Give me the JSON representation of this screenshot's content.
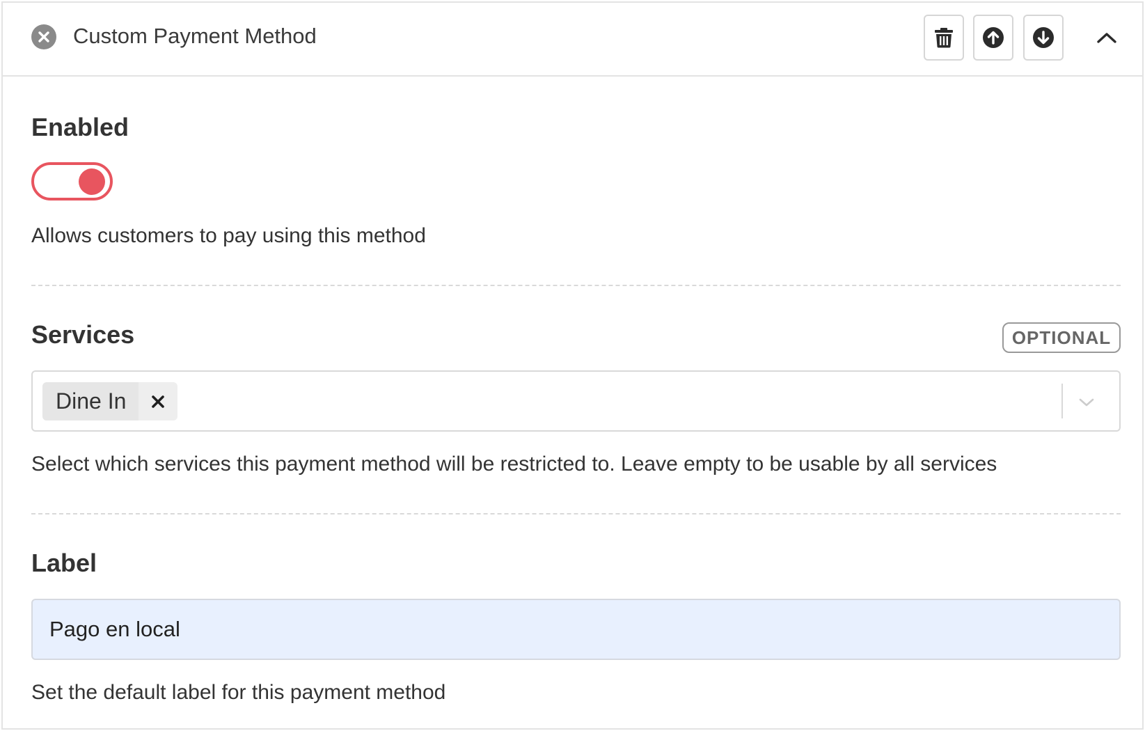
{
  "header": {
    "title": "Custom Payment Method",
    "icons": {
      "dismiss": "close-circle-icon",
      "delete": "trash-icon",
      "move_up": "arrow-up-circle-icon",
      "move_down": "arrow-down-circle-icon",
      "collapse": "chevron-up-icon"
    }
  },
  "enabled": {
    "label": "Enabled",
    "is_on": true,
    "help": "Allows customers to pay using this method"
  },
  "services": {
    "label": "Services",
    "badge": "OPTIONAL",
    "selected": [
      {
        "label": "Dine In"
      }
    ],
    "help": "Select which services this payment method will be restricted to. Leave empty to be usable by all services"
  },
  "label_field": {
    "label": "Label",
    "value": "Pago en local",
    "help": "Set the default label for this payment method"
  },
  "colors": {
    "accent": "#e8555f",
    "input_autofill_bg": "#e8f0fe",
    "border": "#e3e3e3"
  }
}
